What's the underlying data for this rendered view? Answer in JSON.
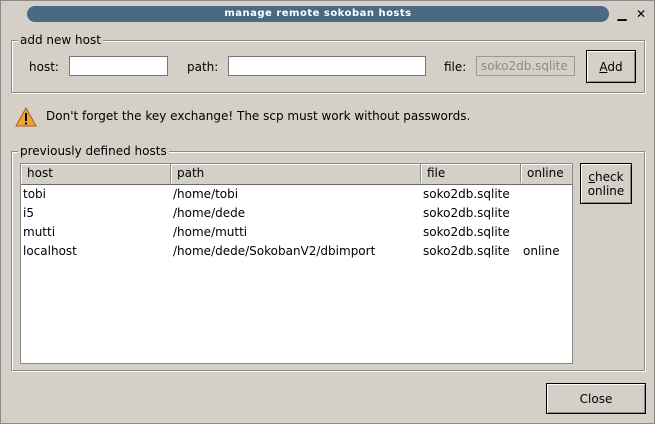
{
  "window": {
    "title": "manage remote sokoban hosts",
    "minimize_glyph": "▁",
    "maximize_glyph": "□",
    "close_glyph": "✕"
  },
  "add_host": {
    "group_title": "add new host",
    "host_label": "host:",
    "host_value": "",
    "path_label": "path:",
    "path_value": "",
    "file_label": "file:",
    "file_value": "soko2db.sqlite",
    "add_label_key": "A",
    "add_label_rest": "dd"
  },
  "warning": {
    "icon": "warning-icon",
    "text": "Don't forget the key exchange! The scp must work without passwords."
  },
  "hosts": {
    "group_title": "previously defined hosts",
    "columns": [
      "host",
      "path",
      "file",
      "online"
    ],
    "rows": [
      [
        "tobi",
        "/home/tobi",
        "soko2db.sqlite",
        ""
      ],
      [
        "i5",
        "/home/dede",
        "soko2db.sqlite",
        ""
      ],
      [
        "mutti",
        "/home/mutti",
        "soko2db.sqlite",
        ""
      ],
      [
        "localhost",
        "/home/dede/SokobanV2/dbimport",
        "soko2db.sqlite",
        "online"
      ]
    ],
    "check_key": "c",
    "check_rest_line1": "heck",
    "check_line2": "online"
  },
  "footer": {
    "close_label": "Close"
  },
  "colors": {
    "title_bar": "#4b6983",
    "background": "#d4d0c8",
    "warning": "#f2a33a"
  }
}
